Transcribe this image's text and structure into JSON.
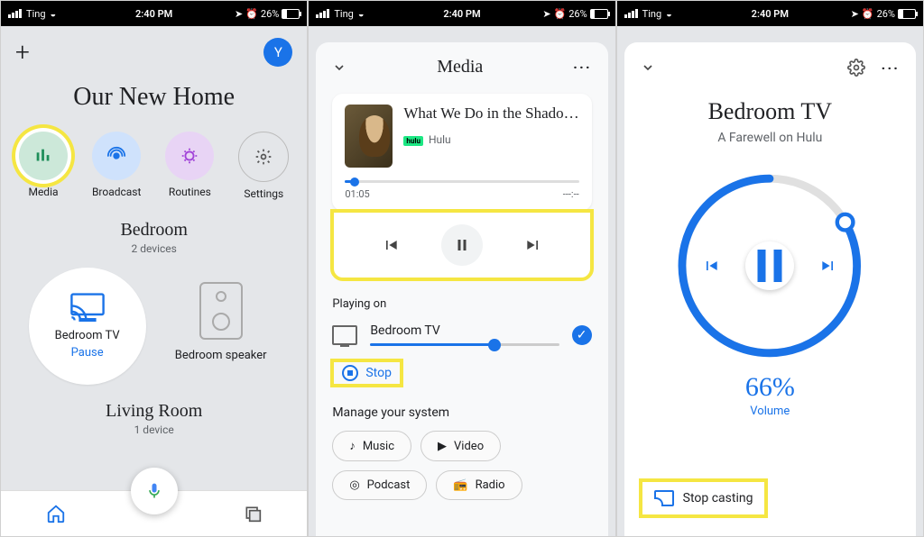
{
  "status": {
    "carrier": "Ting",
    "time": "2:40 PM",
    "battery": "26%"
  },
  "p1": {
    "avatar": "Y",
    "home_title": "Our New Home",
    "actions": {
      "media": "Media",
      "broadcast": "Broadcast",
      "routines": "Routines",
      "settings": "Settings"
    },
    "room1": {
      "name": "Bedroom",
      "sub": "2 devices"
    },
    "dev_tv": {
      "name": "Bedroom TV",
      "action": "Pause"
    },
    "dev_speaker": {
      "name": "Bedroom speaker"
    },
    "room2": {
      "name": "Living Room",
      "sub": "1 device"
    }
  },
  "p2": {
    "title": "Media",
    "now": {
      "title": "What We Do in the Shado…",
      "service": "Hulu",
      "elapsed": "01:05",
      "total": "---:--"
    },
    "playing_on": {
      "label": "Playing on",
      "device": "Bedroom TV"
    },
    "stop": "Stop",
    "manage": {
      "title": "Manage your system",
      "music": "Music",
      "video": "Video",
      "podcast": "Podcast",
      "radio": "Radio"
    }
  },
  "p3": {
    "device": "Bedroom TV",
    "subtitle": "A Farewell on Hulu",
    "volume_pct": "66%",
    "volume_label": "Volume",
    "stop_casting": "Stop casting"
  }
}
